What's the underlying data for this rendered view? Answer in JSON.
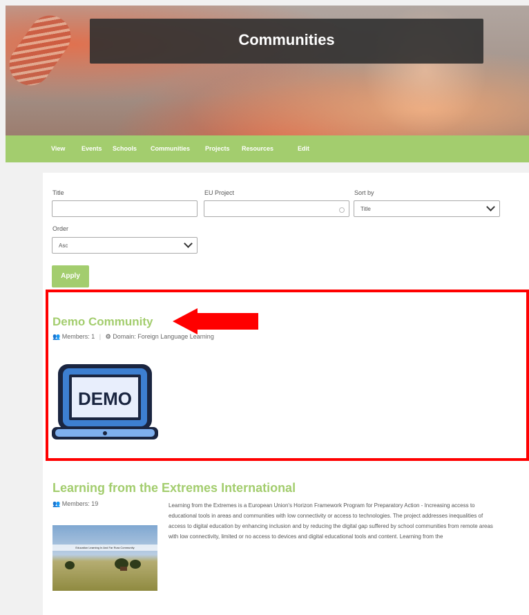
{
  "hero": {
    "title": "Communities"
  },
  "nav": {
    "items": [
      "View",
      "Events",
      "Schools",
      "Communities",
      "Projects",
      "Resources",
      "Edit"
    ]
  },
  "filters": {
    "title_label": "Title",
    "eu_project_label": "EU Project",
    "sort_by_label": "Sort by",
    "sort_by_value": "Title",
    "order_label": "Order",
    "order_value": "Asc",
    "apply_label": "Apply"
  },
  "communities": [
    {
      "title": "Demo Community",
      "members": "Members: 1",
      "domain": "Domain: Foreign Language Learning",
      "image_label": "DEMO"
    },
    {
      "title": "Learning from the Extremes International",
      "members": "Members: 19",
      "thumb_caption": "Education Learning In And Far Rura Community",
      "description": "Learning from the Extremes is a European Union's Horizon Framework Program for Preparatory Action - Increasing access to educational tools in areas and communities with low connectivity or access to technologies. The project addresses inequalities of access to digital education by enhancing inclusion and by reducing the digital gap suffered by school communities from remote areas with low connectivity, limited or no access to devices and digital educational tools and content. Learning from the"
    }
  ],
  "colors": {
    "accent": "#a3cd6e",
    "highlight": "#ff0000",
    "hero_box": "#2d2d2d"
  }
}
